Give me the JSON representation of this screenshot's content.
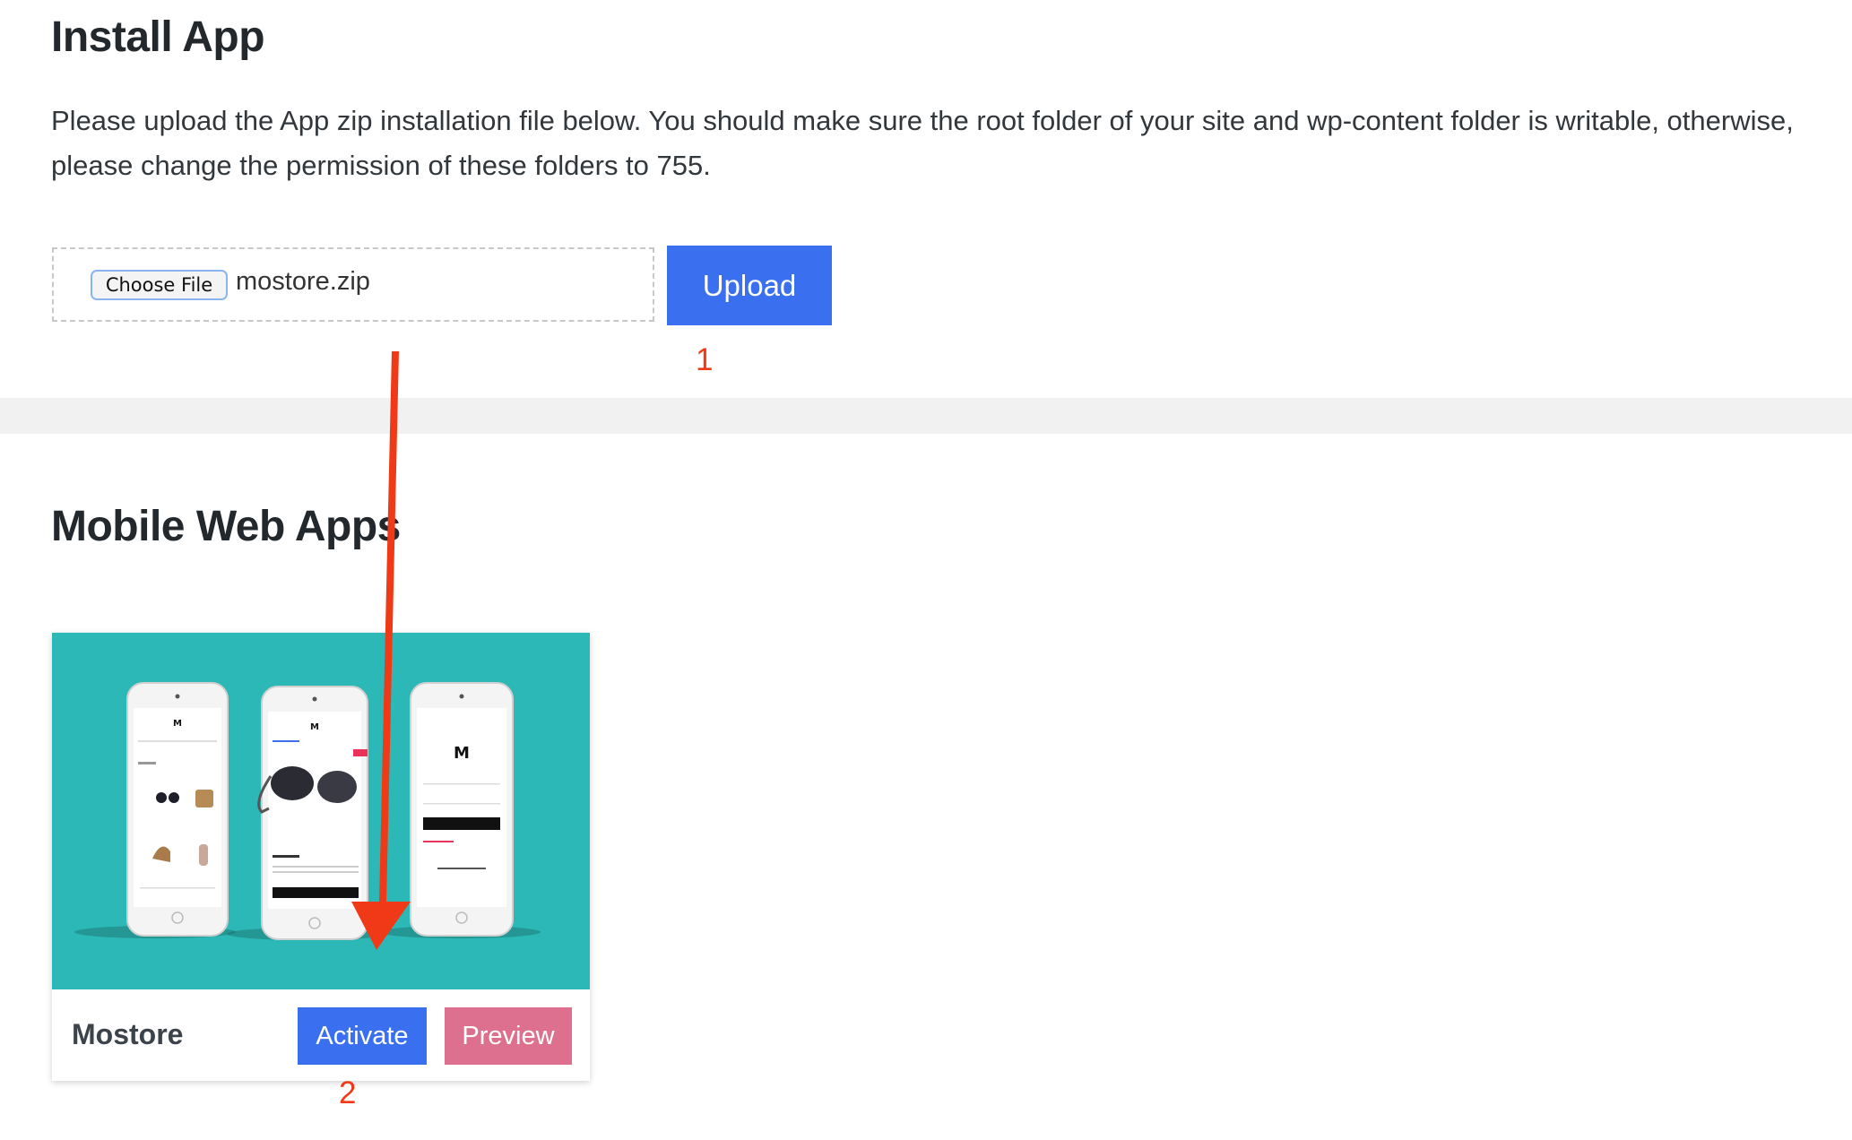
{
  "install": {
    "title": "Install App",
    "description": "Please upload the App zip installation file below. You should make sure the root folder of your site and wp-content folder is writable, otherwise, please change the permission of these folders to 755.",
    "choose_file_label": "Choose File",
    "file_name": "mostore.zip",
    "upload_label": "Upload"
  },
  "apps": {
    "title": "Mobile Web Apps",
    "items": [
      {
        "name": "Mostore",
        "activate_label": "Activate",
        "preview_label": "Preview",
        "thumbnail_bg": "#2cb8b6"
      }
    ]
  },
  "annotations": {
    "step1": "1",
    "step2": "2",
    "arrow_color": "#f03a17"
  },
  "colors": {
    "primary": "#3a6ff0",
    "preview": "#dd6f8f"
  }
}
